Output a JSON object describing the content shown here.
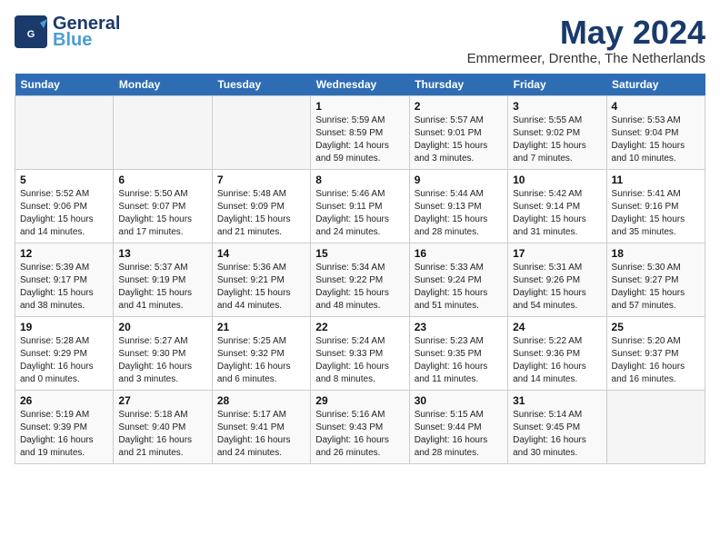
{
  "logo": {
    "line1": "General",
    "line2": "Blue"
  },
  "title": "May 2024",
  "subtitle": "Emmermeer, Drenthe, The Netherlands",
  "days_of_week": [
    "Sunday",
    "Monday",
    "Tuesday",
    "Wednesday",
    "Thursday",
    "Friday",
    "Saturday"
  ],
  "weeks": [
    [
      {
        "day": "",
        "info": ""
      },
      {
        "day": "",
        "info": ""
      },
      {
        "day": "",
        "info": ""
      },
      {
        "day": "1",
        "info": "Sunrise: 5:59 AM\nSunset: 8:59 PM\nDaylight: 14 hours\nand 59 minutes."
      },
      {
        "day": "2",
        "info": "Sunrise: 5:57 AM\nSunset: 9:01 PM\nDaylight: 15 hours\nand 3 minutes."
      },
      {
        "day": "3",
        "info": "Sunrise: 5:55 AM\nSunset: 9:02 PM\nDaylight: 15 hours\nand 7 minutes."
      },
      {
        "day": "4",
        "info": "Sunrise: 5:53 AM\nSunset: 9:04 PM\nDaylight: 15 hours\nand 10 minutes."
      }
    ],
    [
      {
        "day": "5",
        "info": "Sunrise: 5:52 AM\nSunset: 9:06 PM\nDaylight: 15 hours\nand 14 minutes."
      },
      {
        "day": "6",
        "info": "Sunrise: 5:50 AM\nSunset: 9:07 PM\nDaylight: 15 hours\nand 17 minutes."
      },
      {
        "day": "7",
        "info": "Sunrise: 5:48 AM\nSunset: 9:09 PM\nDaylight: 15 hours\nand 21 minutes."
      },
      {
        "day": "8",
        "info": "Sunrise: 5:46 AM\nSunset: 9:11 PM\nDaylight: 15 hours\nand 24 minutes."
      },
      {
        "day": "9",
        "info": "Sunrise: 5:44 AM\nSunset: 9:13 PM\nDaylight: 15 hours\nand 28 minutes."
      },
      {
        "day": "10",
        "info": "Sunrise: 5:42 AM\nSunset: 9:14 PM\nDaylight: 15 hours\nand 31 minutes."
      },
      {
        "day": "11",
        "info": "Sunrise: 5:41 AM\nSunset: 9:16 PM\nDaylight: 15 hours\nand 35 minutes."
      }
    ],
    [
      {
        "day": "12",
        "info": "Sunrise: 5:39 AM\nSunset: 9:17 PM\nDaylight: 15 hours\nand 38 minutes."
      },
      {
        "day": "13",
        "info": "Sunrise: 5:37 AM\nSunset: 9:19 PM\nDaylight: 15 hours\nand 41 minutes."
      },
      {
        "day": "14",
        "info": "Sunrise: 5:36 AM\nSunset: 9:21 PM\nDaylight: 15 hours\nand 44 minutes."
      },
      {
        "day": "15",
        "info": "Sunrise: 5:34 AM\nSunset: 9:22 PM\nDaylight: 15 hours\nand 48 minutes."
      },
      {
        "day": "16",
        "info": "Sunrise: 5:33 AM\nSunset: 9:24 PM\nDaylight: 15 hours\nand 51 minutes."
      },
      {
        "day": "17",
        "info": "Sunrise: 5:31 AM\nSunset: 9:26 PM\nDaylight: 15 hours\nand 54 minutes."
      },
      {
        "day": "18",
        "info": "Sunrise: 5:30 AM\nSunset: 9:27 PM\nDaylight: 15 hours\nand 57 minutes."
      }
    ],
    [
      {
        "day": "19",
        "info": "Sunrise: 5:28 AM\nSunset: 9:29 PM\nDaylight: 16 hours\nand 0 minutes."
      },
      {
        "day": "20",
        "info": "Sunrise: 5:27 AM\nSunset: 9:30 PM\nDaylight: 16 hours\nand 3 minutes."
      },
      {
        "day": "21",
        "info": "Sunrise: 5:25 AM\nSunset: 9:32 PM\nDaylight: 16 hours\nand 6 minutes."
      },
      {
        "day": "22",
        "info": "Sunrise: 5:24 AM\nSunset: 9:33 PM\nDaylight: 16 hours\nand 8 minutes."
      },
      {
        "day": "23",
        "info": "Sunrise: 5:23 AM\nSunset: 9:35 PM\nDaylight: 16 hours\nand 11 minutes."
      },
      {
        "day": "24",
        "info": "Sunrise: 5:22 AM\nSunset: 9:36 PM\nDaylight: 16 hours\nand 14 minutes."
      },
      {
        "day": "25",
        "info": "Sunrise: 5:20 AM\nSunset: 9:37 PM\nDaylight: 16 hours\nand 16 minutes."
      }
    ],
    [
      {
        "day": "26",
        "info": "Sunrise: 5:19 AM\nSunset: 9:39 PM\nDaylight: 16 hours\nand 19 minutes."
      },
      {
        "day": "27",
        "info": "Sunrise: 5:18 AM\nSunset: 9:40 PM\nDaylight: 16 hours\nand 21 minutes."
      },
      {
        "day": "28",
        "info": "Sunrise: 5:17 AM\nSunset: 9:41 PM\nDaylight: 16 hours\nand 24 minutes."
      },
      {
        "day": "29",
        "info": "Sunrise: 5:16 AM\nSunset: 9:43 PM\nDaylight: 16 hours\nand 26 minutes."
      },
      {
        "day": "30",
        "info": "Sunrise: 5:15 AM\nSunset: 9:44 PM\nDaylight: 16 hours\nand 28 minutes."
      },
      {
        "day": "31",
        "info": "Sunrise: 5:14 AM\nSunset: 9:45 PM\nDaylight: 16 hours\nand 30 minutes."
      },
      {
        "day": "",
        "info": ""
      }
    ]
  ]
}
